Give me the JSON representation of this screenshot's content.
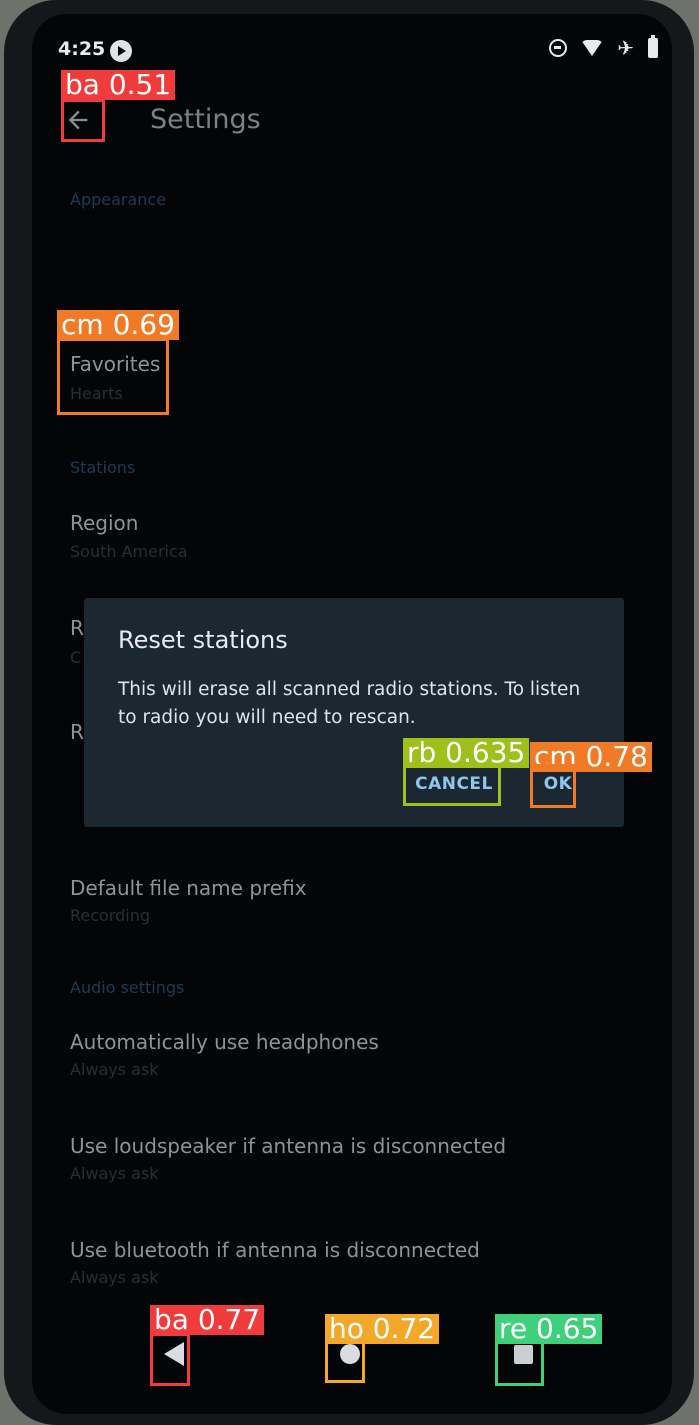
{
  "status_bar": {
    "time": "4:25",
    "icons": [
      "app-notification-icon",
      "do-not-disturb-icon",
      "wifi-icon",
      "airplane-icon",
      "battery-icon"
    ]
  },
  "toolbar": {
    "back_icon": "arrow-back-icon",
    "title": "Settings"
  },
  "settings": {
    "appearance_header": "Appearance",
    "favorites_title": "Favorites",
    "favorites_summary": "Hearts",
    "stations_header": "Stations",
    "region_title": "Region",
    "region_summary": "South America",
    "hidden_item_1_letter": "R",
    "hidden_item_1_summary_letter": "C",
    "hidden_item_2_letter": "R",
    "prefix_title": "Default file name prefix",
    "prefix_summary": "Recording",
    "audio_header": "Audio settings",
    "headphones_title": "Automatically use headphones",
    "headphones_summary": "Always ask",
    "loudspeaker_title": "Use loudspeaker if antenna is disconnected",
    "loudspeaker_summary": "Always ask",
    "bluetooth_title": "Use bluetooth if antenna is disconnected",
    "bluetooth_summary": "Always ask"
  },
  "dialog": {
    "title": "Reset stations",
    "message": "This will erase all scanned radio stations. To listen to radio you will need to rescan.",
    "cancel_label": "CANCEL",
    "ok_label": "OK"
  },
  "nav_bar": {
    "back_icon": "triangle-back-icon",
    "home_icon": "circle-home-icon",
    "recents_icon": "square-recents-icon"
  },
  "detections": [
    {
      "label": "ba 0.51",
      "color": "#ef3b3b"
    },
    {
      "label": "cm 0.69",
      "color": "#f07a26"
    },
    {
      "label": "rb 0.635",
      "color": "#9fc01a"
    },
    {
      "label": "cm 0.78",
      "color": "#f07a26"
    },
    {
      "label": "ba 0.77",
      "color": "#ef3b3b"
    },
    {
      "label": "ho 0.72",
      "color": "#f3a82a"
    },
    {
      "label": "re 0.65",
      "color": "#3ed07a"
    }
  ]
}
